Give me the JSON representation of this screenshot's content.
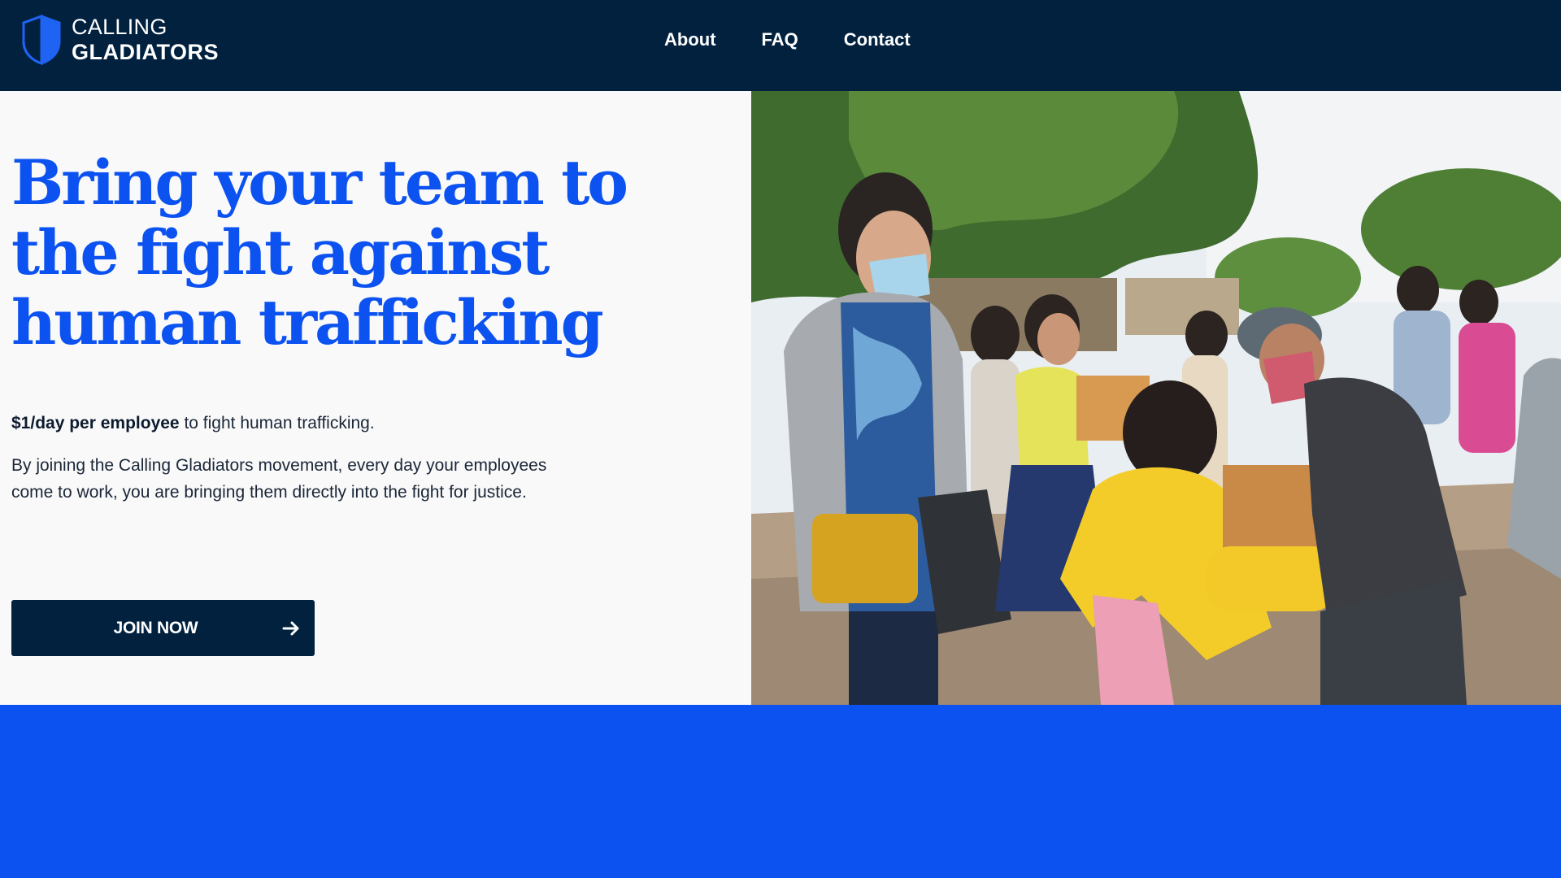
{
  "brand": {
    "line1": "CALLING",
    "line2": "GLADIATORS",
    "logo_icon": "shield-icon",
    "colors": {
      "shield": "#1f63f2",
      "header_bg": "#02213f"
    }
  },
  "nav": {
    "items": [
      {
        "label": "About"
      },
      {
        "label": "FAQ"
      },
      {
        "label": "Contact"
      }
    ]
  },
  "hero": {
    "title": "Bring your team to the fight against human trafficking",
    "tagline_bold": "$1/day per employee",
    "tagline_rest": " to fight human trafficking.",
    "intro": "By joining the Calling Gladiators movement, every day your employees come to work, you are bringing them directly into the fight for justice.",
    "cta_label": "JOIN NOW",
    "cta_icon": "arrow-right-icon",
    "photo_icon": "hero-photo"
  },
  "colors": {
    "accent": "#0b52f0",
    "dark": "#02213f",
    "hero_bg": "#f9f9fa",
    "text": "#1b2737"
  }
}
